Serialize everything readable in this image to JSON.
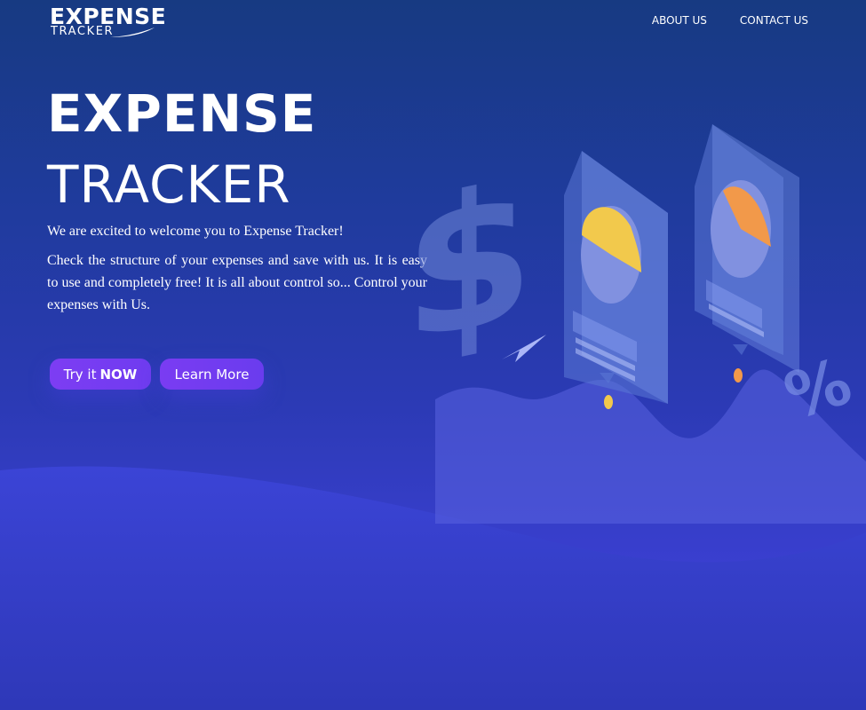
{
  "header": {
    "logo_top": "EXPENSE",
    "logo_bottom": "TRACKER",
    "nav": [
      {
        "label": "ABOUT US"
      },
      {
        "label": "CONTACT US"
      }
    ]
  },
  "hero": {
    "title_line1": "EXPENSE",
    "title_line2": "TRACKER",
    "welcome": "We are excited to welcome you to Expense Tracker!",
    "description": "Check the structure of your expenses and save with us. It is easy to use and completely free! It is all about control so... Control your expenses with Us.",
    "primary_button": {
      "prefix": "Try it",
      "emphasis": "NOW"
    },
    "secondary_button": {
      "label": "Learn More"
    }
  },
  "colors": {
    "background_top": "#173a82",
    "background_bottom": "#2e38b8",
    "button": "#7b3cf2",
    "chart_yellow": "#f2c94c",
    "chart_orange": "#f2994a"
  },
  "icons": [
    "dollar-icon",
    "paper-plane-icon",
    "percent-icon",
    "pie-chart-icon"
  ]
}
